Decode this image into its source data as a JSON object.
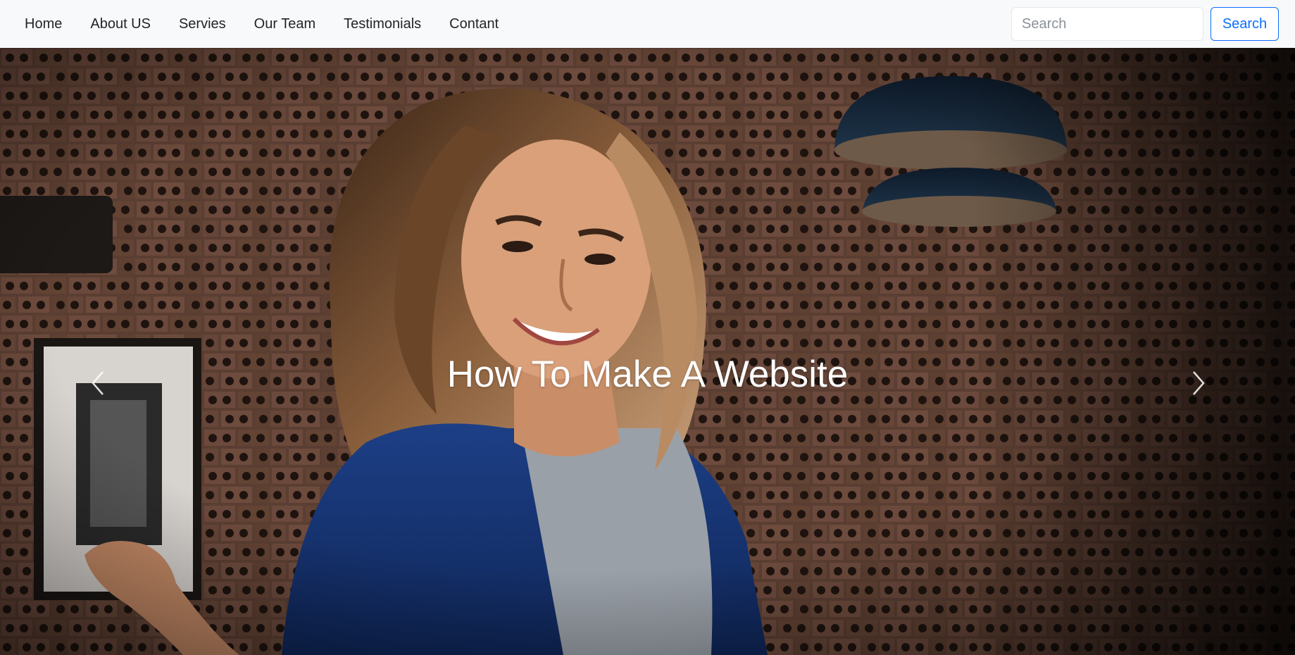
{
  "nav": {
    "links": [
      "Home",
      "About US",
      "Servies",
      "Our Team",
      "Testimonials",
      "Contant"
    ],
    "search_placeholder": "Search",
    "search_button": "Search"
  },
  "carousel": {
    "caption": "How To Make A Website",
    "prev_icon": "chevron-left-icon",
    "next_icon": "chevron-right-icon",
    "image": "woman-smiling-brick-wall-photo"
  },
  "colors": {
    "navbar_bg": "#f8f9fa",
    "primary": "#0d6efd",
    "caption_text": "#ffffff"
  }
}
